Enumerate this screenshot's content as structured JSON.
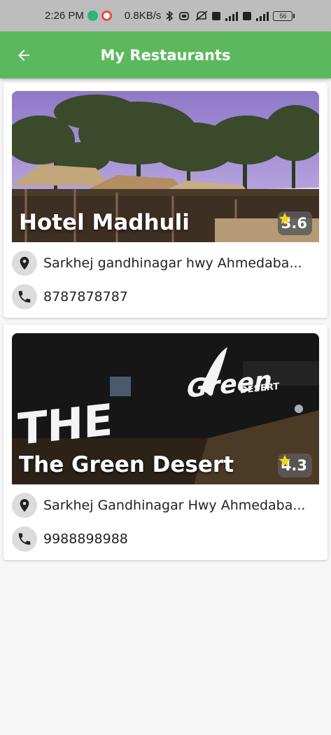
{
  "status_bar": {
    "time": "2:26 PM",
    "speed": "0.8KB/s",
    "battery": "56",
    "icons": [
      "bluetooth-icon",
      "vibrate-icon",
      "mute-icon",
      "volte-icon",
      "signal-icon"
    ]
  },
  "app_bar": {
    "title": "My Restaurants",
    "back_icon": "arrow-left-icon",
    "color": "#5cb85c"
  },
  "restaurants": [
    {
      "name": "Hotel Madhuli",
      "rating": "3.6",
      "address": "Sarkhej gandhinagar hwy Ahmedaba...",
      "phone": "8787878787"
    },
    {
      "name": "The Green Desert",
      "rating": "4.3",
      "address": "Sarkhej Gandhinagar Hwy Ahmedaba...",
      "phone": "9988898988"
    }
  ],
  "image_text": {
    "sign_the": "THE",
    "sign_green": "Green",
    "sign_desert": "DESERT"
  }
}
